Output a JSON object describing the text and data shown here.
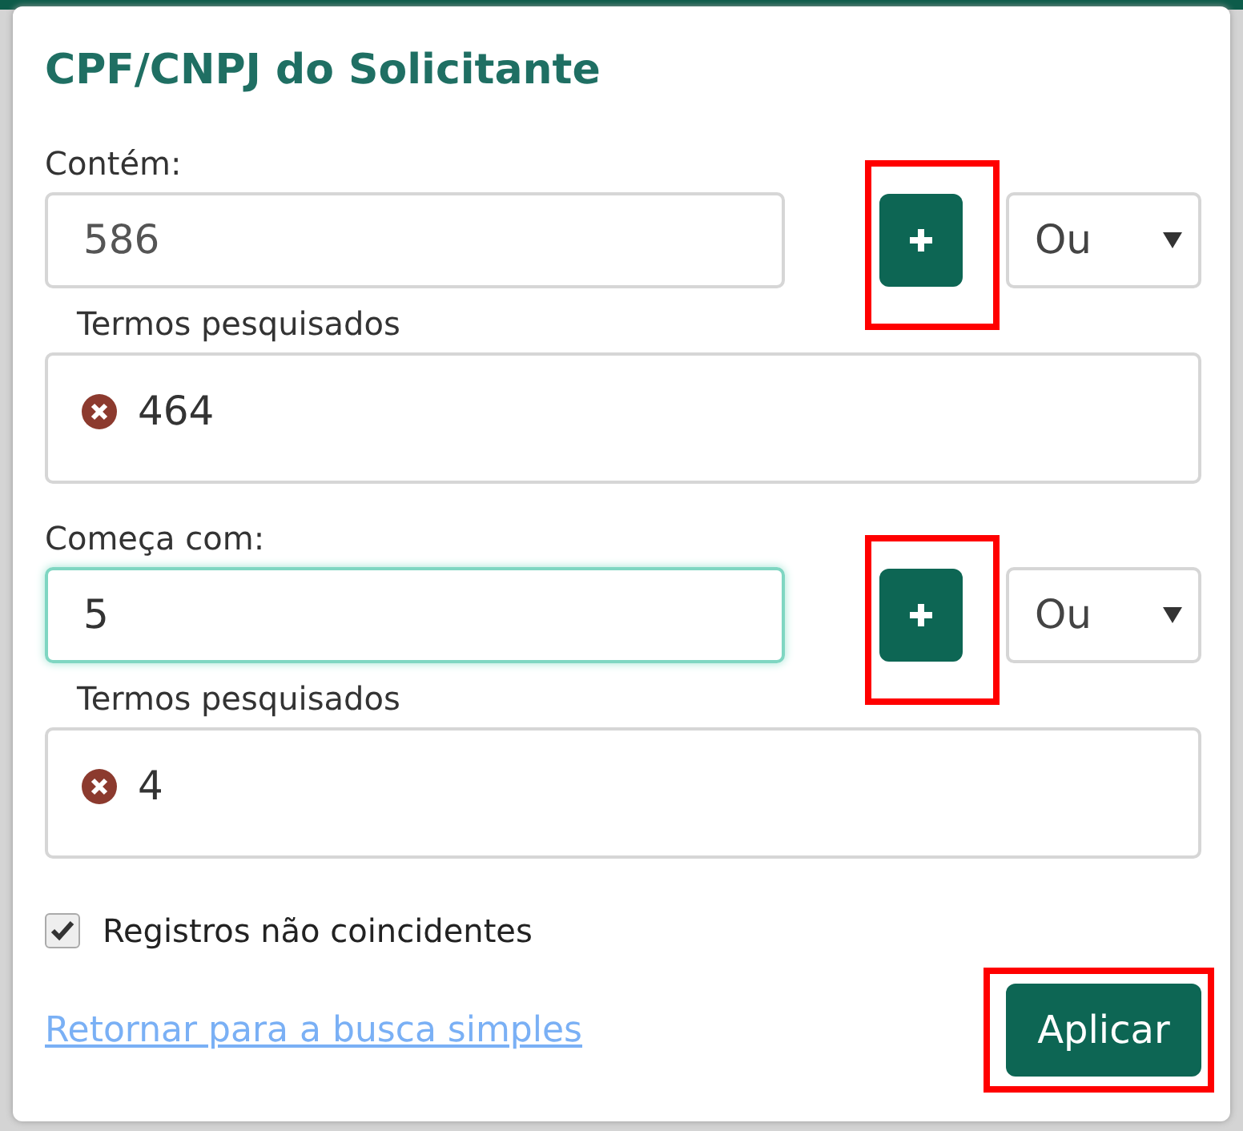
{
  "title": "CPF/CNPJ do Solicitante",
  "filters": [
    {
      "label": "Contém:",
      "value": "586",
      "focused": false,
      "add_highlighted": true,
      "operator": "Ou",
      "terms_label": "Termos pesquisados",
      "terms": [
        "464"
      ]
    },
    {
      "label": "Começa com:",
      "value": "5",
      "focused": true,
      "add_highlighted": true,
      "operator": "Ou",
      "terms_label": "Termos pesquisados",
      "terms": [
        "4"
      ]
    }
  ],
  "non_matching": {
    "label": "Registros não coincidentes",
    "checked": true
  },
  "back_link": "Retornar para a busca simples",
  "apply": {
    "label": "Aplicar",
    "highlighted": true
  }
}
